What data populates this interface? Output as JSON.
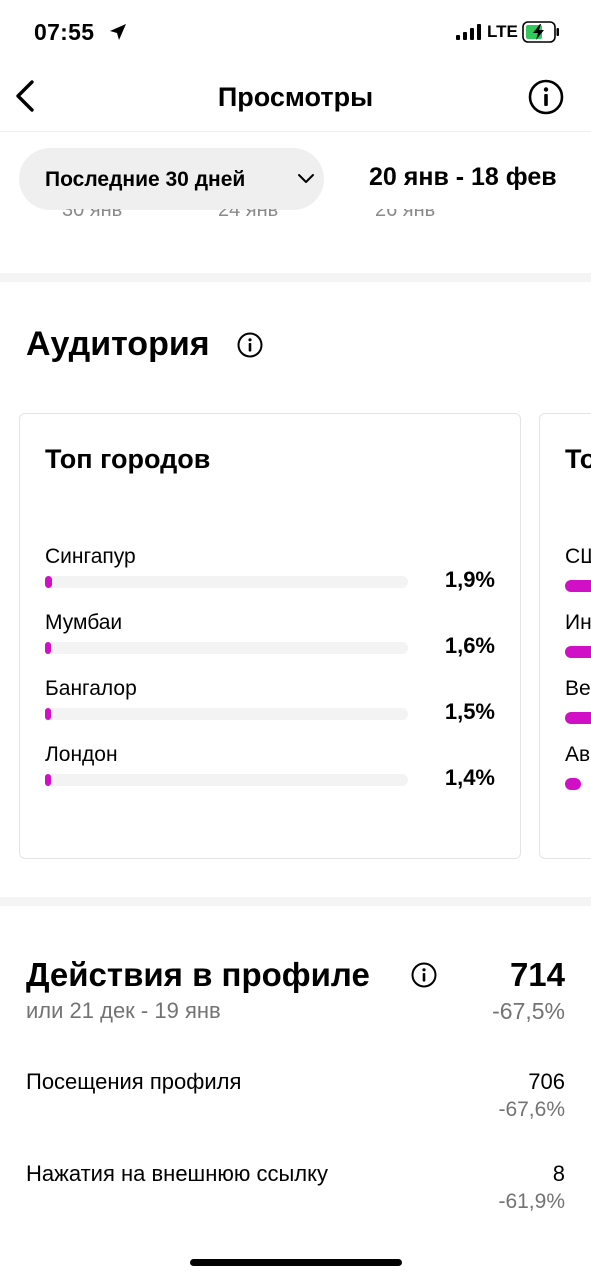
{
  "status_bar": {
    "time": "07:55",
    "network": "LTE"
  },
  "nav": {
    "title": "Просмотры"
  },
  "filter": {
    "range_label": "Последние 30 дней",
    "date_range": "20 янв - 18 фев"
  },
  "chart_axis_cut": [
    "30 янв",
    "24 янв",
    "26 янв"
  ],
  "audience": {
    "title": "Аудитория",
    "top_cities": {
      "title": "Топ городов",
      "items": [
        {
          "name": "Сингапур",
          "percent": "1,9%",
          "value": 1.9
        },
        {
          "name": "Мумбаи",
          "percent": "1,6%",
          "value": 1.6
        },
        {
          "name": "Бангалор",
          "percent": "1,5%",
          "value": 1.5
        },
        {
          "name": "Лондон",
          "percent": "1,4%",
          "value": 1.4
        }
      ]
    },
    "second_card_partial": {
      "title": "То",
      "items": [
        "СШ",
        "Ин",
        "Ве",
        "Ав"
      ]
    }
  },
  "profile_actions": {
    "title": "Действия в профиле",
    "total": "714",
    "compare_label": "или 21 дек - 19 янв",
    "total_delta": "-67,5%",
    "metrics": [
      {
        "label": "Посещения профиля",
        "value": "706",
        "delta": "-67,6%"
      },
      {
        "label": "Нажатия на внешнюю ссылку",
        "value": "8",
        "delta": "-61,9%"
      }
    ]
  },
  "colors": {
    "accent": "#d10fc7",
    "muted": "#737373"
  }
}
